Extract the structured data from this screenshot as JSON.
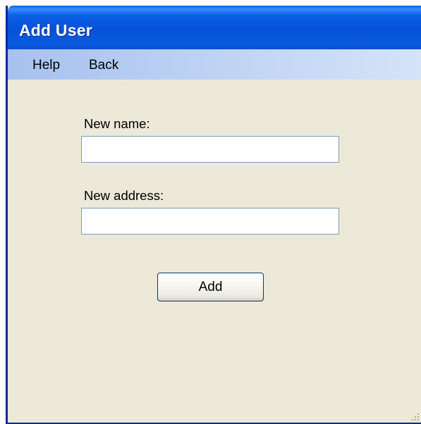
{
  "window": {
    "title": "Add User"
  },
  "menu": {
    "items": [
      {
        "label": "Help"
      },
      {
        "label": "Back"
      }
    ]
  },
  "form": {
    "name_label": "New name:",
    "name_value": "",
    "address_label": "New address:",
    "address_value": "",
    "add_button_label": "Add"
  },
  "colors": {
    "titlebar": "#0651d8",
    "window_bg": "#ece9d8",
    "menubar": "#bcd1f3",
    "input_border": "#7f9db9",
    "button_border": "#003c74"
  },
  "icons": {
    "resize_grip": "size-grip-icon"
  }
}
